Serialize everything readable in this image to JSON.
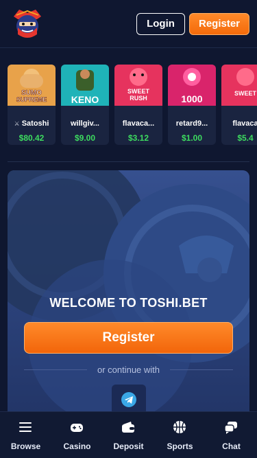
{
  "header": {
    "logo_icon": "samurai-logo-icon",
    "login_label": "Login",
    "register_label": "Register"
  },
  "recent_wins": [
    {
      "game_art": "SUMO SUPREME MEGAWAYS",
      "user": "Satoshi",
      "user_icon": "incognito-icon",
      "amount": "$80.42"
    },
    {
      "game_art": "KENO",
      "user": "willgiv...",
      "amount": "$9.00"
    },
    {
      "game_art": "SWEET RUSH BONANZA",
      "user": "flavaca...",
      "amount": "$3.12"
    },
    {
      "game_art": "SWEET BONANZA 1000",
      "user": "retard9...",
      "amount": "$1.00"
    },
    {
      "game_art": "SWEET RUSH BONANZA",
      "user": "flavaca",
      "amount": "$5.4"
    }
  ],
  "welcome": {
    "title": "WELCOME TO TOSHI.BET",
    "register_label": "Register",
    "or_text": "or continue with",
    "social_icon": "telegram-icon"
  },
  "bottom_nav": [
    {
      "label": "Browse",
      "icon": "menu-icon"
    },
    {
      "label": "Casino",
      "icon": "gamepad-icon"
    },
    {
      "label": "Deposit",
      "icon": "wallet-icon"
    },
    {
      "label": "Sports",
      "icon": "basketball-icon"
    },
    {
      "label": "Chat",
      "icon": "chat-icon"
    }
  ],
  "colors": {
    "background": "#0f1730",
    "accent_orange": "#f46a0a",
    "win_green": "#3ddc5f",
    "panel_blue": "#2a3f78"
  }
}
